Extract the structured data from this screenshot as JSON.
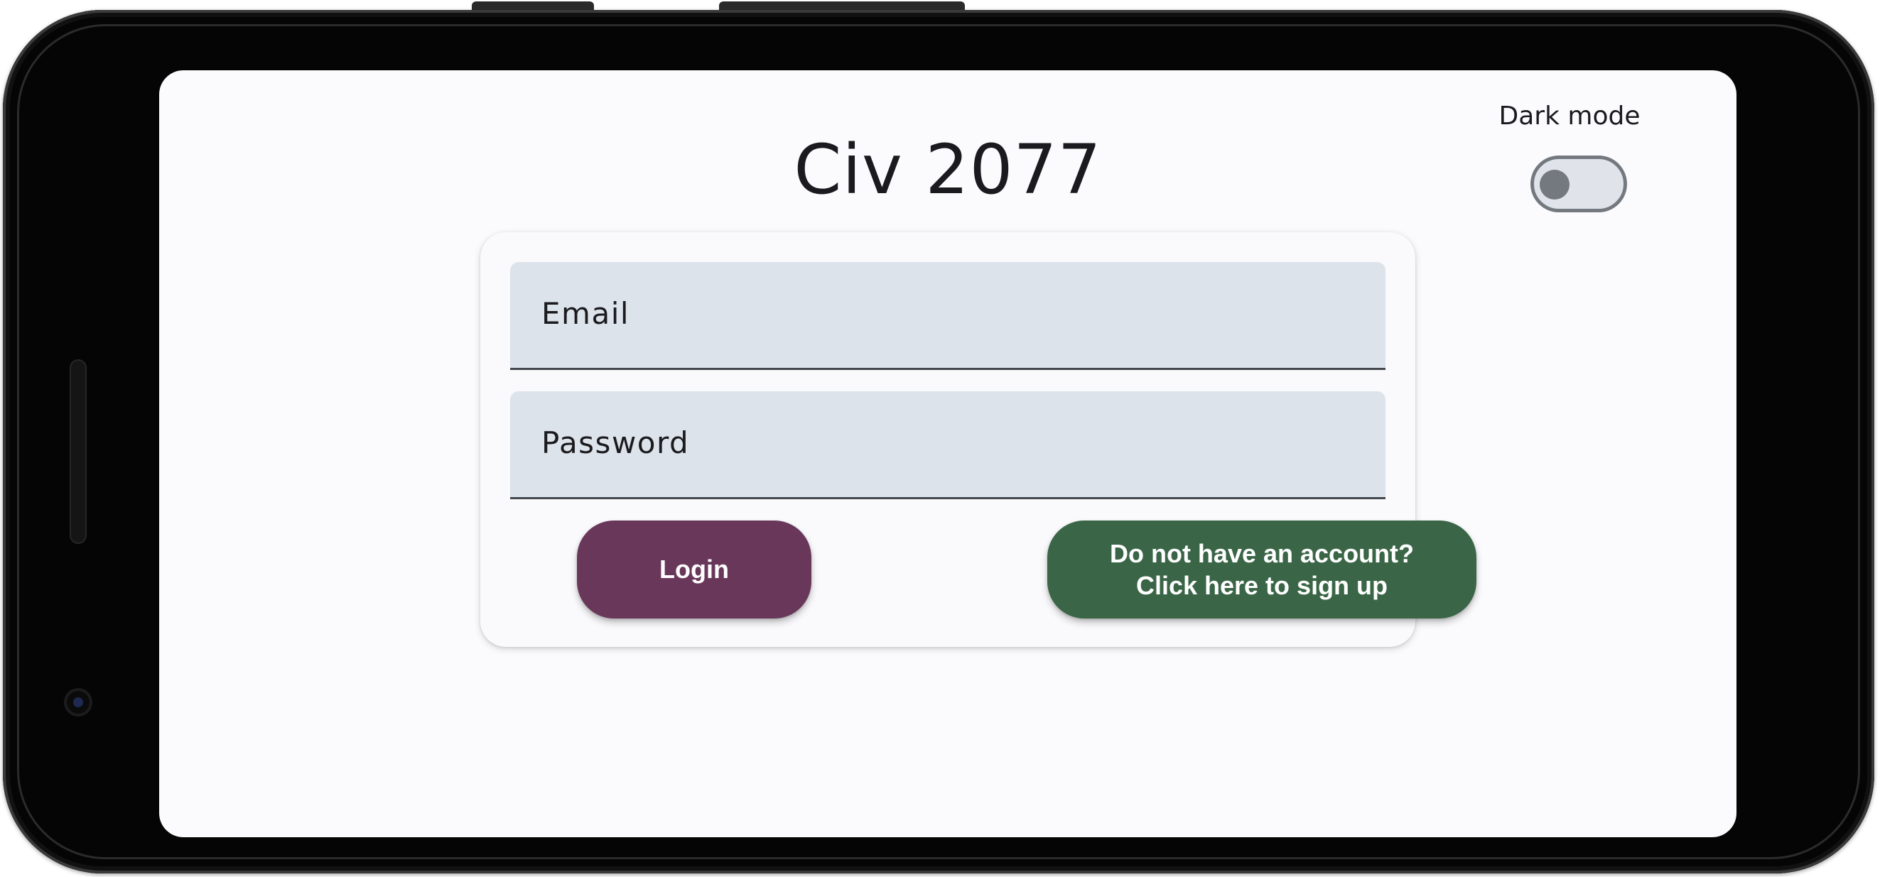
{
  "app": {
    "title": "Civ 2077"
  },
  "dark_mode": {
    "label": "Dark mode",
    "enabled": false
  },
  "login_form": {
    "email_placeholder": "Email",
    "password_placeholder": "Password",
    "login_label": "Login",
    "signup_line1": "Do not have an account?",
    "signup_line2": "Click here to sign up"
  },
  "colors": {
    "login_button": "#69375a",
    "signup_button": "#3a6647",
    "field_background": "#dde3ea"
  }
}
